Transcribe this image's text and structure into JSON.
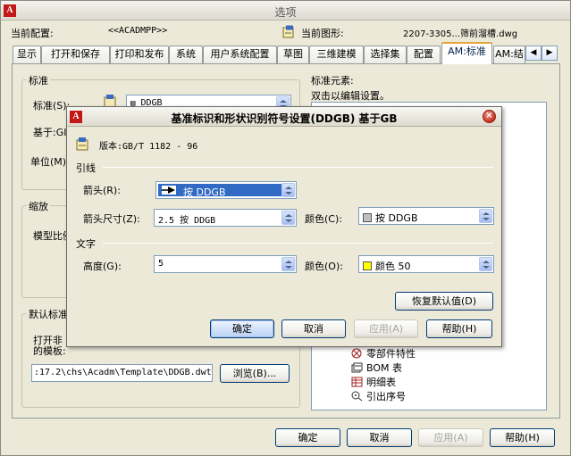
{
  "main": {
    "title": "选项",
    "current_config_label": "当前配置:",
    "current_config_value": "<<ACADMPP>>",
    "current_drawing_label": "当前图形:",
    "current_drawing_value": "2207-3305...筛前溜槽.dwg"
  },
  "tabs": [
    "显示",
    "打开和保存",
    "打印和发布",
    "系统",
    "用户系统配置",
    "草图",
    "三维建模",
    "选择集",
    "配置",
    "AM:标准",
    "AM:结"
  ],
  "active_tab": "AM:标准",
  "standard_group": {
    "title": "标准",
    "standard_label": "标准(S):",
    "standard_value": "DDGB",
    "based_on_label": "基于:GI",
    "unit_label": "单位(M)"
  },
  "scale_group": {
    "title": "缩放",
    "model_scale_label": "模型比例"
  },
  "default_standard_group": {
    "title": "默认标准",
    "open_text_1": "打开非",
    "open_text_2": "的模板:",
    "template_path": ":17.2\\chs\\Acadm\\Template\\DDGB.dwt",
    "browse_label": "浏览(B)..."
  },
  "standard_elements": {
    "title": "标准元素:",
    "hint": "双击以编辑设置。",
    "items": [
      {
        "label": "零部件特性",
        "icon": "part-properties-icon"
      },
      {
        "label": "BOM 表",
        "icon": "bom-table-icon"
      },
      {
        "label": "明细表",
        "icon": "parts-list-icon"
      },
      {
        "label": "引出序号",
        "icon": "balloon-icon"
      }
    ]
  },
  "main_buttons": {
    "ok": "确定",
    "cancel": "取消",
    "apply": "应用(A)",
    "help": "帮助(H)"
  },
  "dialog": {
    "title": "基准标识和形状识别符号设置(DDGB) 基于GB",
    "version": "版本:GB/T 1182 - 96",
    "leader_section": "引线",
    "arrow_label": "箭头(R):",
    "arrow_value": "按 DDGB",
    "arrow_size_label": "箭头尺寸(Z):",
    "arrow_size_value": "2.5  按 DDGB",
    "leader_color_label": "颜色(C):",
    "leader_color_value": "按 DDGB",
    "text_section": "文字",
    "height_label": "高度(G):",
    "height_value": "5",
    "text_color_label": "颜色(O):",
    "text_color_value": "颜色 50",
    "restore_label": "恢复默认值(D)",
    "ok": "确定",
    "cancel": "取消",
    "apply": "应用(A)",
    "help": "帮助(H)"
  },
  "colors": {
    "leader_color": "#c0c0c0",
    "text_color": "#ffff00",
    "selection": "#316ac5",
    "active_tab_accent": "#e6a23a",
    "close_button": "#c3301d"
  }
}
